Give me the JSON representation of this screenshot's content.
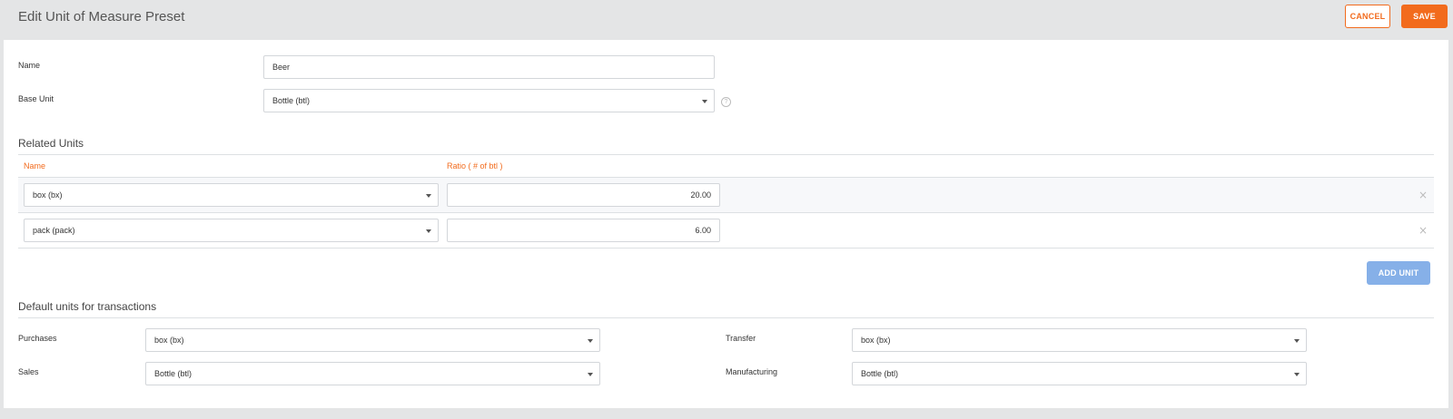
{
  "header": {
    "title": "Edit Unit of Measure Preset",
    "cancel_label": "CANCEL",
    "save_label": "SAVE"
  },
  "form": {
    "name_label": "Name",
    "name_value": "Beer",
    "base_unit_label": "Base Unit",
    "base_unit_value": "Bottle (btl)",
    "help_icon": "question-circle-icon"
  },
  "related_units": {
    "title": "Related Units",
    "columns": [
      "Name",
      "Ratio ( # of btl )"
    ],
    "rows": [
      {
        "unit": "box (bx)",
        "ratio": "20.00"
      },
      {
        "unit": "pack (pack)",
        "ratio": "6.00"
      }
    ],
    "remove_icon": "close-icon",
    "add_label": "ADD UNIT"
  },
  "defaults": {
    "title": "Default units for transactions",
    "purchases_label": "Purchases",
    "purchases_value": "box (bx)",
    "sales_label": "Sales",
    "sales_value": "Bottle (btl)",
    "transfer_label": "Transfer",
    "transfer_value": "box (bx)",
    "manufacturing_label": "Manufacturing",
    "manufacturing_value": "Bottle (btl)"
  },
  "colors": {
    "accent": "#f26b1d",
    "add_button": "#86b0e8",
    "background": "#e4e5e6"
  }
}
